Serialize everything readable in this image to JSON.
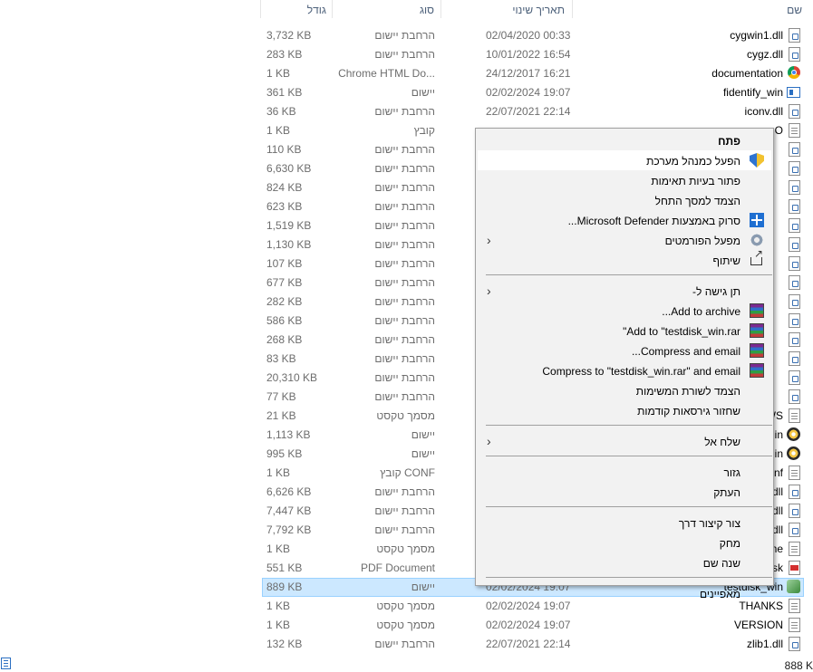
{
  "columns": {
    "size": "גודל",
    "type": "סוג",
    "date": "תאריך שינוי",
    "name": "שם"
  },
  "files": [
    {
      "name": "cygwin1.dll",
      "date": "02/04/2020 00:33",
      "type": "הרחבת יישום",
      "size": "3,732 KB",
      "icon": "dll-icon"
    },
    {
      "name": "cygz.dll",
      "date": "10/01/2022 16:54",
      "type": "הרחבת יישום",
      "size": "283 KB",
      "icon": "dll-icon"
    },
    {
      "name": "documentation",
      "date": "24/12/2017 16:21",
      "type": "Chrome HTML Do...",
      "size": "1 KB",
      "icon": "chrome-icon"
    },
    {
      "name": "fidentify_win",
      "date": "02/02/2024 19:07",
      "type": "יישום",
      "size": "361 KB",
      "icon": "app-icon"
    },
    {
      "name": "iconv.dll",
      "date": "22/07/2021 22:14",
      "type": "הרחבת יישום",
      "size": "36 KB",
      "icon": "dll-icon"
    },
    {
      "name": "O",
      "date": "",
      "type": "קובץ",
      "size": "1 KB",
      "icon": "file-icon"
    },
    {
      "name": "",
      "date": "",
      "type": "הרחבת יישום",
      "size": "110 KB",
      "icon": "dll-icon"
    },
    {
      "name": "",
      "date": "",
      "type": "הרחבת יישום",
      "size": "6,630 KB",
      "icon": "dll-icon"
    },
    {
      "name": "",
      "date": "",
      "type": "הרחבת יישום",
      "size": "824 KB",
      "icon": "dll-icon"
    },
    {
      "name": "",
      "date": "",
      "type": "הרחבת יישום",
      "size": "623 KB",
      "icon": "dll-icon"
    },
    {
      "name": "",
      "date": "",
      "type": "הרחבת יישום",
      "size": "1,519 KB",
      "icon": "dll-icon"
    },
    {
      "name": "",
      "date": "",
      "type": "הרחבת יישום",
      "size": "1,130 KB",
      "icon": "dll-icon"
    },
    {
      "name": "",
      "date": "",
      "type": "הרחבת יישום",
      "size": "107 KB",
      "icon": "dll-icon"
    },
    {
      "name": "",
      "date": "",
      "type": "הרחבת יישום",
      "size": "677 KB",
      "icon": "dll-icon"
    },
    {
      "name": "",
      "date": "",
      "type": "הרחבת יישום",
      "size": "282 KB",
      "icon": "dll-icon"
    },
    {
      "name": "",
      "date": "",
      "type": "הרחבת יישום",
      "size": "586 KB",
      "icon": "dll-icon"
    },
    {
      "name": "",
      "date": "",
      "type": "הרחבת יישום",
      "size": "268 KB",
      "icon": "dll-icon"
    },
    {
      "name": "",
      "date": "",
      "type": "הרחבת יישום",
      "size": "83 KB",
      "icon": "dll-icon"
    },
    {
      "name": "",
      "date": "",
      "type": "הרחבת יישום",
      "size": "20,310 KB",
      "icon": "dll-icon"
    },
    {
      "name": "",
      "date": "",
      "type": "הרחבת יישום",
      "size": "77 KB",
      "icon": "dll-icon"
    },
    {
      "name": "WS",
      "date": "",
      "type": "מסמך טקסט",
      "size": "21 KB",
      "icon": "doc-icon"
    },
    {
      "name": "in",
      "date": "",
      "type": "יישום",
      "size": "1,113 KB",
      "icon": "disk-icon"
    },
    {
      "name": "in",
      "date": "",
      "type": "יישום",
      "size": "995 KB",
      "icon": "disk-icon"
    },
    {
      "name": "nf",
      "date": "",
      "type": "קובץ CONF",
      "size": "1 KB",
      "icon": "file-icon"
    },
    {
      "name": "dll",
      "date": "",
      "type": "הרחבת יישום",
      "size": "6,626 KB",
      "icon": "dll-icon"
    },
    {
      "name": "dll",
      "date": "",
      "type": "הרחבת יישום",
      "size": "7,447 KB",
      "icon": "dll-icon"
    },
    {
      "name": "dll",
      "date": "",
      "type": "הרחבת יישום",
      "size": "7,792 KB",
      "icon": "dll-icon"
    },
    {
      "name": "me",
      "date": "",
      "type": "מסמך טקסט",
      "size": "1 KB",
      "icon": "doc-icon"
    },
    {
      "name": "sk",
      "date": "",
      "type": "PDF Document",
      "size": "551 KB",
      "icon": "pdf-icon"
    },
    {
      "name": "testdisk_win",
      "date": "02/02/2024 19:07",
      "type": "יישום",
      "size": "889 KB",
      "icon": "testdisk-icon",
      "selected": true
    },
    {
      "name": "THANKS",
      "date": "02/02/2024 19:07",
      "type": "מסמך טקסט",
      "size": "1 KB",
      "icon": "doc-icon"
    },
    {
      "name": "VERSION",
      "date": "02/02/2024 19:07",
      "type": "מסמך טקסט",
      "size": "1 KB",
      "icon": "doc-icon"
    },
    {
      "name": "zlib1.dll",
      "date": "22/07/2021 22:14",
      "type": "הרחבת יישום",
      "size": "132 KB",
      "icon": "dll-icon"
    }
  ],
  "status": {
    "selected_size": "888 K"
  },
  "context_menu": {
    "items": [
      {
        "label": "פתח",
        "bold": true,
        "icon": "",
        "submenu": false
      },
      {
        "label": "הפעל כמנהל מערכת",
        "icon": "uac-shield-icon",
        "highlight": true,
        "submenu": false
      },
      {
        "label": "פתור בעיות תאימות",
        "icon": "",
        "submenu": false
      },
      {
        "label": "הצמד למסך התחל",
        "icon": "",
        "submenu": false
      },
      {
        "label": "סרוק באמצעות Microsoft Defender...",
        "icon": "defender-icon",
        "submenu": false
      },
      {
        "label": "מפעל הפורמטים",
        "icon": "format-factory-icon",
        "submenu": true
      },
      {
        "label": "שיתוף",
        "icon": "share-icon",
        "submenu": false
      },
      {
        "sep": true
      },
      {
        "label": "תן גישה ל-",
        "icon": "",
        "submenu": true
      },
      {
        "label": "Add to archive...",
        "icon": "winrar-icon",
        "submenu": false
      },
      {
        "label": "Add to \"testdisk_win.rar\"",
        "icon": "winrar-icon",
        "submenu": false
      },
      {
        "label": "Compress and email...",
        "icon": "winrar-icon",
        "submenu": false
      },
      {
        "label": "Compress to \"testdisk_win.rar\" and email",
        "icon": "winrar-icon",
        "submenu": false
      },
      {
        "label": "הצמד לשורת המשימות",
        "icon": "",
        "submenu": false
      },
      {
        "label": "שחזור גירסאות קודמות",
        "icon": "",
        "submenu": false
      },
      {
        "sep": true
      },
      {
        "label": "שלח אל",
        "icon": "",
        "submenu": true
      },
      {
        "sep": true
      },
      {
        "label": "גזור",
        "icon": "",
        "submenu": false
      },
      {
        "label": "העתק",
        "icon": "",
        "submenu": false
      },
      {
        "sep": true
      },
      {
        "label": "צור קיצור דרך",
        "icon": "",
        "submenu": false
      },
      {
        "label": "מחק",
        "icon": "",
        "submenu": false
      },
      {
        "label": "שנה שם",
        "icon": "",
        "submenu": false
      },
      {
        "sep": true
      },
      {
        "label": "מאפיינים",
        "icon": "",
        "submenu": false
      }
    ]
  }
}
